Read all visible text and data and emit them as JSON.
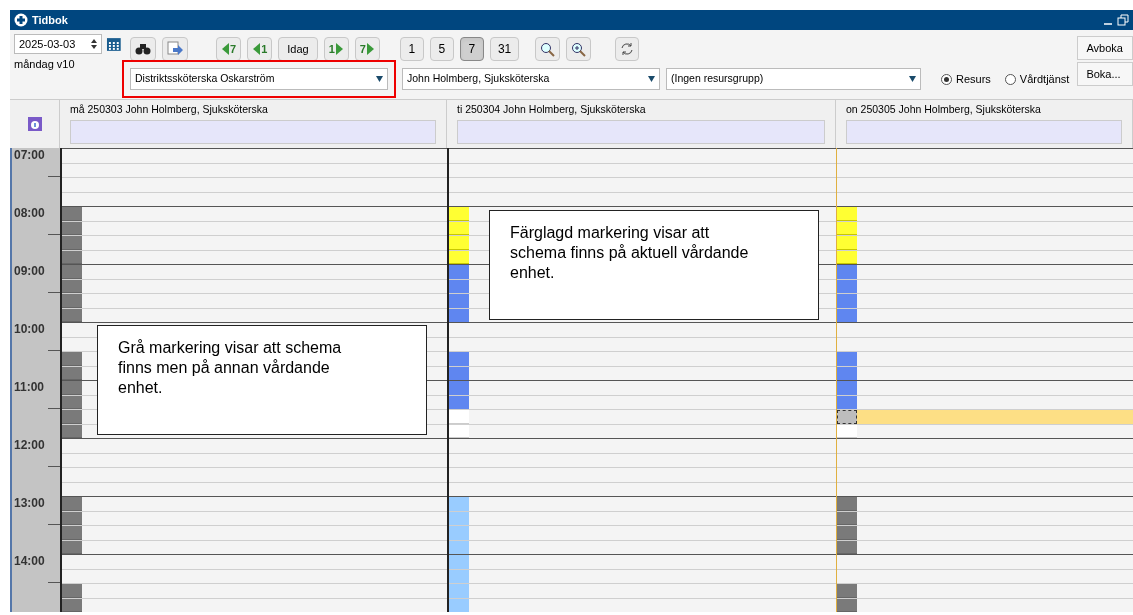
{
  "window": {
    "title": "Tidbok"
  },
  "toolbar": {
    "date": "2025-03-03",
    "weekday": "måndag v10",
    "nav": [
      {
        "kind": "back",
        "label": "7"
      },
      {
        "kind": "back",
        "label": "1"
      },
      {
        "kind": "text",
        "label": "Idag"
      },
      {
        "kind": "forward",
        "label": "1"
      },
      {
        "kind": "forward",
        "label": "7"
      }
    ],
    "views": [
      {
        "label": "1",
        "selected": false
      },
      {
        "label": "5",
        "selected": false
      },
      {
        "label": "7",
        "selected": true
      },
      {
        "label": "31",
        "selected": false
      }
    ],
    "dropdowns": [
      {
        "value": "Distriktssköterska Oskarström",
        "highlighted": true
      },
      {
        "value": "John Holmberg, Sjuksköterska",
        "highlighted": false
      },
      {
        "value": "(Ingen resursgrupp)",
        "highlighted": false
      }
    ],
    "radios": [
      {
        "label": "Resurs",
        "selected": true
      },
      {
        "label": "Vårdtjänst",
        "selected": false
      }
    ],
    "actions": [
      "Avboka",
      "Boka..."
    ]
  },
  "hours": [
    "07:00",
    "08:00",
    "09:00",
    "10:00",
    "11:00",
    "12:00",
    "13:00",
    "14:00"
  ],
  "days": [
    {
      "header": "må 250303 John Holmberg, Sjuksköterska",
      "current": false,
      "slots": [
        {
          "kind": "empty"
        },
        {
          "kind": "empty"
        },
        {
          "kind": "empty"
        },
        {
          "kind": "empty"
        },
        {
          "kind": "grey"
        },
        {
          "kind": "grey"
        },
        {
          "kind": "grey"
        },
        {
          "kind": "grey"
        },
        {
          "kind": "grey"
        },
        {
          "kind": "grey"
        },
        {
          "kind": "grey"
        },
        {
          "kind": "grey"
        },
        {
          "kind": "empty"
        },
        {
          "kind": "empty"
        },
        {
          "kind": "grey"
        },
        {
          "kind": "grey"
        },
        {
          "kind": "grey"
        },
        {
          "kind": "grey"
        },
        {
          "kind": "grey"
        },
        {
          "kind": "grey"
        },
        {
          "kind": "empty"
        },
        {
          "kind": "empty"
        },
        {
          "kind": "empty"
        },
        {
          "kind": "empty"
        },
        {
          "kind": "grey"
        },
        {
          "kind": "grey"
        },
        {
          "kind": "grey"
        },
        {
          "kind": "grey"
        },
        {
          "kind": "empty"
        },
        {
          "kind": "empty"
        },
        {
          "kind": "grey"
        },
        {
          "kind": "grey"
        }
      ]
    },
    {
      "header": "ti 250304 John Holmberg, Sjuksköterska",
      "current": false,
      "slots": [
        {
          "kind": "empty"
        },
        {
          "kind": "empty"
        },
        {
          "kind": "empty"
        },
        {
          "kind": "empty"
        },
        {
          "kind": "yellow"
        },
        {
          "kind": "yellow"
        },
        {
          "kind": "yellow"
        },
        {
          "kind": "yellow"
        },
        {
          "kind": "blue"
        },
        {
          "kind": "blue"
        },
        {
          "kind": "blue"
        },
        {
          "kind": "blue"
        },
        {
          "kind": "empty"
        },
        {
          "kind": "empty"
        },
        {
          "kind": "blue"
        },
        {
          "kind": "blue"
        },
        {
          "kind": "blue"
        },
        {
          "kind": "blue"
        },
        {
          "kind": "white"
        },
        {
          "kind": "white"
        },
        {
          "kind": "empty"
        },
        {
          "kind": "empty"
        },
        {
          "kind": "empty"
        },
        {
          "kind": "empty"
        },
        {
          "kind": "lightblue"
        },
        {
          "kind": "lightblue"
        },
        {
          "kind": "lightblue"
        },
        {
          "kind": "lightblue"
        },
        {
          "kind": "lightblue"
        },
        {
          "kind": "lightblue"
        },
        {
          "kind": "lightblue"
        },
        {
          "kind": "lightblue"
        }
      ]
    },
    {
      "header": "on 250305 John Holmberg, Sjuksköterska",
      "current": true,
      "slots": [
        {
          "kind": "empty"
        },
        {
          "kind": "empty"
        },
        {
          "kind": "empty"
        },
        {
          "kind": "empty"
        },
        {
          "kind": "yellow"
        },
        {
          "kind": "yellow"
        },
        {
          "kind": "yellow"
        },
        {
          "kind": "yellow"
        },
        {
          "kind": "blue"
        },
        {
          "kind": "blue"
        },
        {
          "kind": "blue"
        },
        {
          "kind": "blue"
        },
        {
          "kind": "empty"
        },
        {
          "kind": "empty"
        },
        {
          "kind": "blue"
        },
        {
          "kind": "blue"
        },
        {
          "kind": "blue"
        },
        {
          "kind": "blue"
        },
        {
          "kind": "booked"
        },
        {
          "kind": "white"
        },
        {
          "kind": "empty"
        },
        {
          "kind": "empty"
        },
        {
          "kind": "empty"
        },
        {
          "kind": "empty"
        },
        {
          "kind": "grey"
        },
        {
          "kind": "grey"
        },
        {
          "kind": "grey"
        },
        {
          "kind": "grey"
        },
        {
          "kind": "empty"
        },
        {
          "kind": "empty"
        },
        {
          "kind": "grey"
        },
        {
          "kind": "grey"
        }
      ]
    }
  ],
  "callouts": [
    {
      "text": "Grå markering visar att schema finns men på annan vårdande enhet."
    },
    {
      "text": "Färglagd markering visar att schema finns på aktuell vårdande enhet."
    }
  ]
}
